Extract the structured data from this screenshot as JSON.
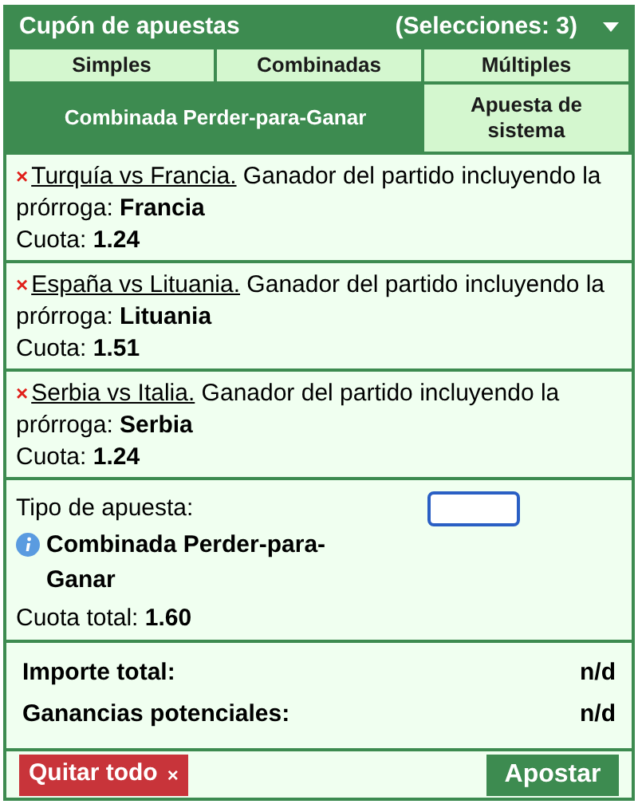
{
  "header": {
    "title": "Cupón de apuestas",
    "count": "(Selecciones: 3)"
  },
  "tabs": [
    {
      "label": "Simples",
      "selected": false
    },
    {
      "label": "Combinadas",
      "selected": false
    },
    {
      "label": "Múltiples",
      "selected": false
    },
    {
      "label": "Combinada Perder-para-Ganar",
      "selected": true
    },
    {
      "label": "Apuesta de sistema",
      "selected": false
    }
  ],
  "selections": [
    {
      "match": "Turquía vs Francia.",
      "description": "Ganador del partido incluyendo la prórroga: **Francia**",
      "odds_label": "Cuota:",
      "odds": "1.24"
    },
    {
      "match": "España vs Lituania.",
      "description": "Ganador del partido incluyendo la prórroga: **Lituania**",
      "odds_label": "Cuota:",
      "odds": "1.51"
    },
    {
      "match": "Serbia vs Italia.",
      "description": "Ganador del partido incluyendo la prórroga: **Serbia**",
      "odds_label": "Cuota:",
      "odds": "1.24"
    }
  ],
  "bet_type": {
    "label": "Tipo de apuesta:",
    "name": "Combinada Perder-para-Ganar",
    "total_odds_label": "Cuota total:",
    "total_odds": "1.60",
    "stake": {
      "focused": true
    }
  },
  "totals": [
    {
      "label": "Importe total:",
      "value": "n/d"
    },
    {
      "label": "Ganancias potenciales:",
      "value": "n/d"
    }
  ],
  "buttons": {
    "remove_all": "Quitar todo",
    "remove_icon": "×",
    "place_bet": "Apostar"
  }
}
